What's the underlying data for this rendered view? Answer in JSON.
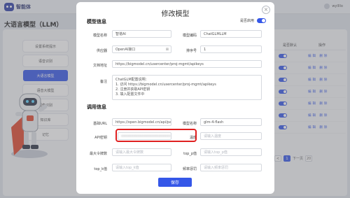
{
  "app": {
    "logo_text": "智能体",
    "user_name": "wyllllo"
  },
  "page": {
    "title": "大语言模型（LLM）"
  },
  "sidebar": {
    "items": [
      {
        "label": "设置系统提示"
      },
      {
        "label": "语音识别"
      },
      {
        "label": "大语言模型"
      },
      {
        "label": "语音大模型"
      },
      {
        "label": "图像识别"
      },
      {
        "label": "知识库"
      },
      {
        "label": "记忆"
      }
    ]
  },
  "table": {
    "col_default": "是否默认",
    "col_action": "操作",
    "rows": [
      {
        "action": "编辑 删除"
      },
      {
        "action": "编辑 删除"
      },
      {
        "action": "编辑 删除"
      },
      {
        "action": "编辑 删除"
      },
      {
        "action": "编辑 删除"
      },
      {
        "action": "编辑 删除"
      },
      {
        "action": "编辑 删除"
      }
    ]
  },
  "pager": {
    "prev": "<",
    "page1": "1",
    "next_label": "下一页",
    "last": "20"
  },
  "modal": {
    "title": "修改模型",
    "close_icon": "×",
    "model_info_title": "模型信息",
    "enable_label": "是否启用",
    "fields": {
      "model_name_label": "模型名称",
      "model_name_value": "智谱AI",
      "model_code_label": "模型编码",
      "model_code_value": "ChatGLMLLM",
      "provider_label": "供应器",
      "provider_value": "OpenAI接口",
      "sort_label": "排序号",
      "sort_value": "1",
      "doc_label": "文档地址",
      "doc_value": "https://bigmodel.cn/usercenter/proj-mgmt/apikeys",
      "remark_label": "备注",
      "remark_lines": [
        "ChatGLM配置说明：",
        "1. 访问 https://bigmodel.cn/usercenter/proj-mgmt/apikeys",
        "2. 注册并获取API密钥",
        "3. 填入配置文件中"
      ]
    },
    "call_info_title": "调用信息",
    "call": {
      "base_url_label": "基础URL",
      "base_url_value": "https://open.bigmodel.cn/api/paas/v4/",
      "model_name_label": "模型名称",
      "model_name_value": "glm-4-flash",
      "api_key_label": "API密钥",
      "api_key_value": "••••••••••••••••••••••••",
      "temperature_label": "温度",
      "temperature_placeholder": "请输入温度",
      "max_tokens_label": "最大令牌数",
      "max_tokens_placeholder": "请输入最大令牌数",
      "top_p_label": "top_p值",
      "top_p_placeholder": "请输入top_p值",
      "top_k_label": "top_k值",
      "top_k_placeholder": "请输入top_k值",
      "freq_penalty_label": "频率惩罚",
      "freq_penalty_placeholder": "请输入频率惩罚"
    },
    "save_label": "保存"
  },
  "colors": {
    "primary": "#3557e8",
    "highlight": "#e02020"
  }
}
